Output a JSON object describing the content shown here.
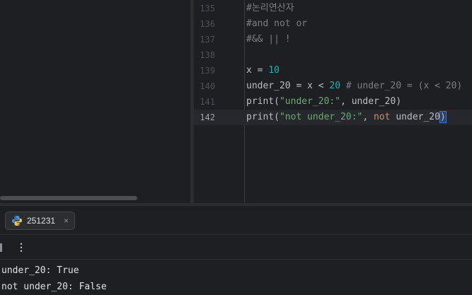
{
  "editor": {
    "lines": [
      {
        "num": "135",
        "tokens": [
          {
            "t": "#논리연산자",
            "c": "cmt"
          }
        ]
      },
      {
        "num": "136",
        "tokens": [
          {
            "t": "#and not or",
            "c": "cmt"
          }
        ]
      },
      {
        "num": "137",
        "tokens": [
          {
            "t": "#&& || !",
            "c": "cmt"
          }
        ]
      },
      {
        "num": "138",
        "tokens": []
      },
      {
        "num": "139",
        "tokens": [
          {
            "t": "x = ",
            "c": "op"
          },
          {
            "t": "10",
            "c": "num"
          }
        ]
      },
      {
        "num": "140",
        "tokens": [
          {
            "t": "under_20 = x < ",
            "c": "op"
          },
          {
            "t": "20",
            "c": "num"
          },
          {
            "t": " # under_20 = (x < 20)",
            "c": "cmt"
          }
        ]
      },
      {
        "num": "141",
        "tokens": [
          {
            "t": "print(",
            "c": "fn"
          },
          {
            "t": "\"under_20:\"",
            "c": "str"
          },
          {
            "t": ", under_20)",
            "c": "op"
          }
        ]
      },
      {
        "num": "142",
        "current": true,
        "tokens": [
          {
            "t": "print(",
            "c": "fn"
          },
          {
            "t": "\"not under_20:\"",
            "c": "str"
          },
          {
            "t": ", ",
            "c": "op"
          },
          {
            "t": "not",
            "c": "kw"
          },
          {
            "t": " under_20",
            "c": "op"
          },
          {
            "t": ")",
            "c": "caret-brace"
          }
        ]
      }
    ]
  },
  "run_panel": {
    "tab_label": "251231",
    "tab_icon": "python-icon",
    "close_glyph": "×",
    "more_glyph": "⋮",
    "output": [
      "under_20: True",
      "not under_20: False"
    ]
  },
  "colors": {
    "background": "#1e1f22",
    "string": "#6aab73",
    "number": "#2aacb8",
    "keyword": "#cf8e6d",
    "comment": "#7a7e85"
  }
}
